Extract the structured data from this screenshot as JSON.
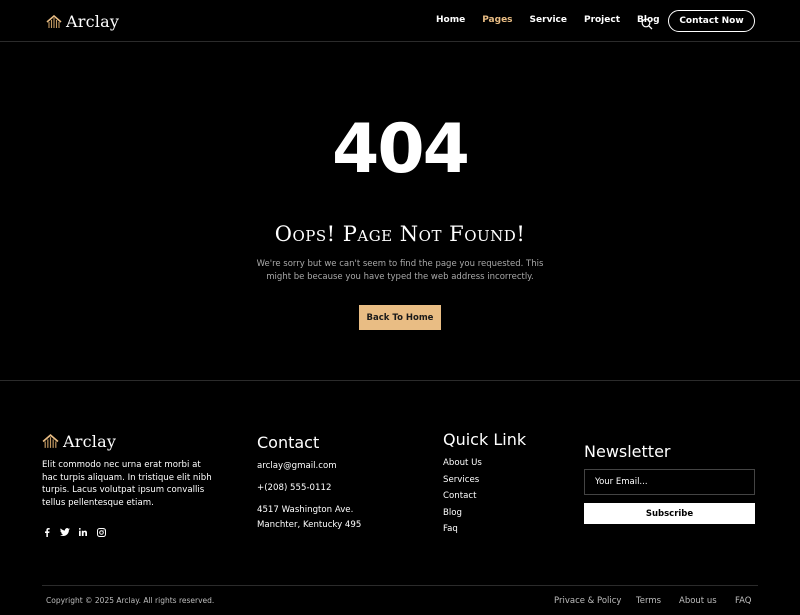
{
  "brand": {
    "name": "Arclay",
    "accent": "#e9bd84"
  },
  "nav": {
    "items": [
      "Home",
      "Pages",
      "Service",
      "Project",
      "Blog"
    ],
    "active": "Pages",
    "cta": "Contact Now"
  },
  "hero": {
    "code": "404",
    "title": "Oops! Page Not Found!",
    "description": "We're sorry but we can't seem to find the page you requested. This might be because you have typed the web address incorrectly.",
    "button": "Back To Home"
  },
  "footer": {
    "about": "Elit commodo nec urna erat morbi at hac turpis aliquam. In tristique elit nibh turpis. Lacus volutpat ipsum convallis tellus pellentesque etiam.",
    "social_icons": [
      "facebook-icon",
      "twitter-icon",
      "linkedin-icon",
      "instagram-icon"
    ],
    "contact": {
      "title": "Contact",
      "email": "arclay@gmail.com",
      "phone": "+(208) 555-0112",
      "address1": "4517 Washington Ave.",
      "address2": "Manchter, Kentucky 495"
    },
    "quick": {
      "title": "Quick Link",
      "links": [
        "About Us",
        "Services",
        "Contact",
        "Blog",
        "Faq"
      ]
    },
    "newsletter": {
      "title": "Newsletter",
      "placeholder": "Your Email...",
      "button": "Subscribe"
    },
    "copyright": "Copyright © 2025 Arclay. All rights reserved.",
    "bottom_links": [
      "Privace & Policy",
      "Terms",
      "About us",
      "FAQ"
    ]
  }
}
